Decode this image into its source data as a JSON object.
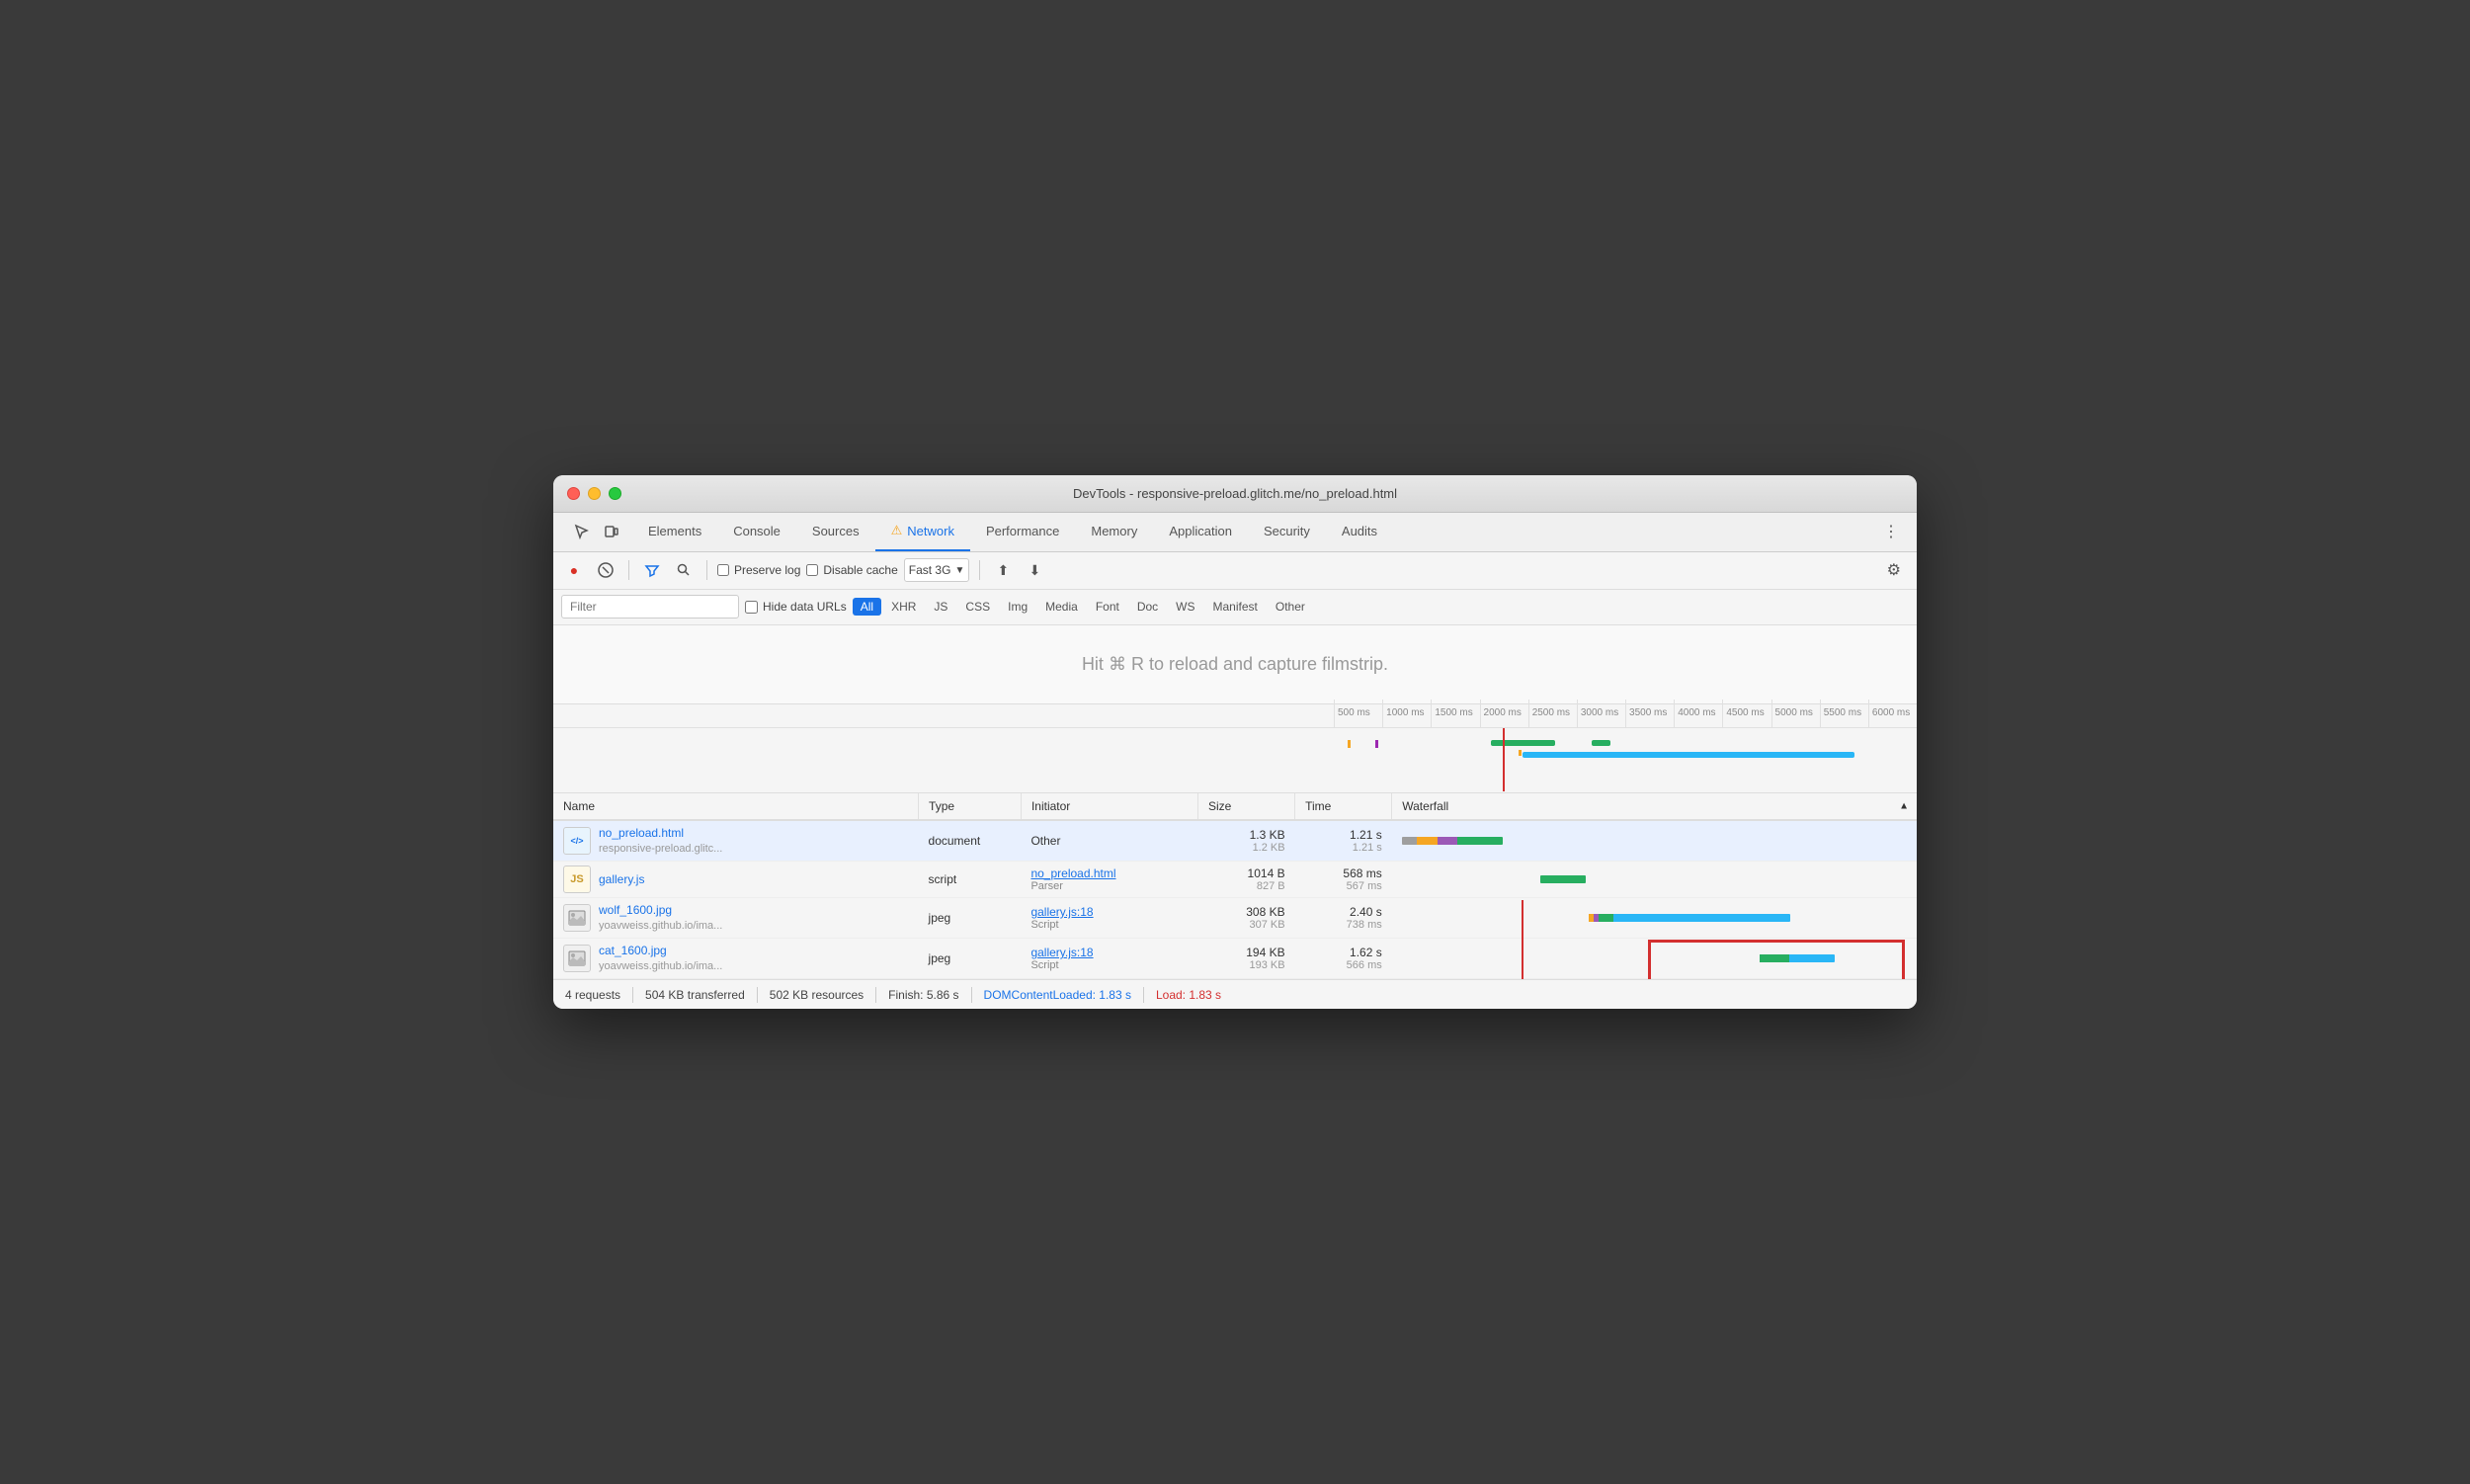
{
  "window": {
    "title": "DevTools - responsive-preload.glitch.me/no_preload.html"
  },
  "tabs": {
    "devtools_icons": [
      "☰",
      "☐"
    ],
    "items": [
      {
        "label": "Elements",
        "active": false
      },
      {
        "label": "Console",
        "active": false
      },
      {
        "label": "Sources",
        "active": false
      },
      {
        "label": "Network",
        "active": true,
        "warn": true
      },
      {
        "label": "Performance",
        "active": false
      },
      {
        "label": "Memory",
        "active": false
      },
      {
        "label": "Application",
        "active": false
      },
      {
        "label": "Security",
        "active": false
      },
      {
        "label": "Audits",
        "active": false
      }
    ],
    "more_icon": "⋮"
  },
  "toolbar": {
    "record_icon": "●",
    "stop_icon": "🚫",
    "preserve_log_label": "Preserve log",
    "disable_cache_label": "Disable cache",
    "throttle_label": "Fast 3G",
    "upload_icon": "⬆",
    "download_icon": "⬇",
    "settings_icon": "⚙"
  },
  "filterbar": {
    "filter_placeholder": "Filter",
    "hide_data_urls_label": "Hide data URLs",
    "chips": [
      "All",
      "XHR",
      "JS",
      "CSS",
      "Img",
      "Media",
      "Font",
      "Doc",
      "WS",
      "Manifest",
      "Other"
    ]
  },
  "filmstrip": {
    "hint": "Hit ⌘ R to reload and capture filmstrip."
  },
  "ruler": {
    "ticks": [
      "500 ms",
      "1000 ms",
      "1500 ms",
      "2000 ms",
      "2500 ms",
      "3000 ms",
      "3500 ms",
      "4000 ms",
      "4500 ms",
      "5000 ms",
      "5500 ms",
      "6000 ms"
    ]
  },
  "table": {
    "headers": [
      "Name",
      "Type",
      "Initiator",
      "Size",
      "Time",
      "Waterfall"
    ],
    "rows": [
      {
        "icon_type": "html",
        "icon_label": "</>",
        "name": "no_preload.html",
        "url": "responsive-preload.glitc...",
        "type": "document",
        "initiator": "Other",
        "initiator_link": false,
        "size1": "1.3 KB",
        "size2": "1.2 KB",
        "time1": "1.21 s",
        "time2": "1.21 s",
        "selected": true
      },
      {
        "icon_type": "js",
        "icon_label": "JS",
        "name": "gallery.js",
        "url": "",
        "type": "script",
        "initiator": "no_preload.html",
        "initiator_link": true,
        "initiator_sub": "Parser",
        "size1": "1014 B",
        "size2": "827 B",
        "time1": "568 ms",
        "time2": "567 ms",
        "selected": false
      },
      {
        "icon_type": "img",
        "icon_label": "🖼",
        "name": "wolf_1600.jpg",
        "url": "yoavweiss.github.io/ima...",
        "type": "jpeg",
        "initiator": "gallery.js:18",
        "initiator_link": true,
        "initiator_sub": "Script",
        "size1": "308 KB",
        "size2": "307 KB",
        "time1": "2.40 s",
        "time2": "738 ms",
        "selected": false
      },
      {
        "icon_type": "img",
        "icon_label": "🖼",
        "name": "cat_1600.jpg",
        "url": "yoavweiss.github.io/ima...",
        "type": "jpeg",
        "initiator": "gallery.js:18",
        "initiator_link": true,
        "initiator_sub": "Script",
        "size1": "194 KB",
        "size2": "193 KB",
        "time1": "1.62 s",
        "time2": "566 ms",
        "selected": false
      }
    ]
  },
  "statusbar": {
    "requests": "4 requests",
    "transferred": "504 KB transferred",
    "resources": "502 KB resources",
    "finish": "Finish: 5.86 s",
    "dom_content_loaded": "DOMContentLoaded: 1.83 s",
    "load": "Load: 1.83 s"
  }
}
